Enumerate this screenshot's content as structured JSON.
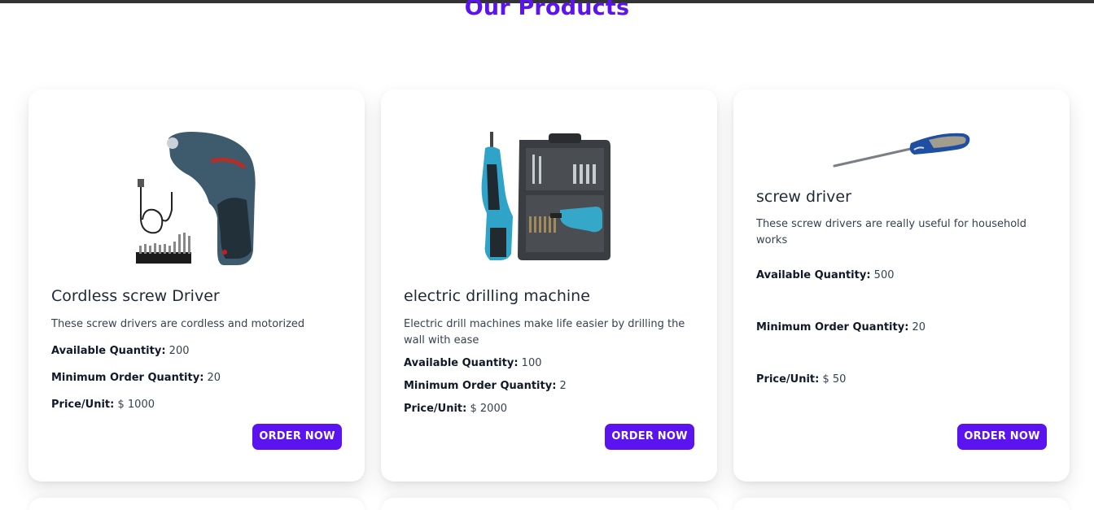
{
  "page": {
    "title": "Our Products"
  },
  "products": [
    {
      "name": "Cordless screw Driver",
      "description": "These screw drivers are cordless and motorized",
      "available_label": "Available Quantity:",
      "available_value": "200",
      "min_order_label": "Minimum Order Quantity:",
      "min_order_value": "20",
      "price_label": "Price/Unit:",
      "price_value": "$ 1000",
      "button_label": "ORDER NOW",
      "image": "cordless-screwdriver-image"
    },
    {
      "name": "electric drilling machine",
      "description": "Electric drill machines make life easier by drilling the wall with ease",
      "available_label": "Available Quantity:",
      "available_value": "100",
      "min_order_label": "Minimum Order Quantity:",
      "min_order_value": "2",
      "price_label": "Price/Unit:",
      "price_value": "$ 2000",
      "button_label": "ORDER NOW",
      "image": "drill-kit-image"
    },
    {
      "name": "screw driver",
      "description": "These screw drivers are really useful for household works",
      "available_label": "Available Quantity:",
      "available_value": "500",
      "min_order_label": "Minimum Order Quantity:",
      "min_order_value": "20",
      "price_label": "Price/Unit:",
      "price_value": "$ 50",
      "button_label": "ORDER NOW",
      "image": "screwdriver-image"
    }
  ],
  "colors": {
    "accent": "#5b14f0",
    "text": "#1f2937"
  }
}
